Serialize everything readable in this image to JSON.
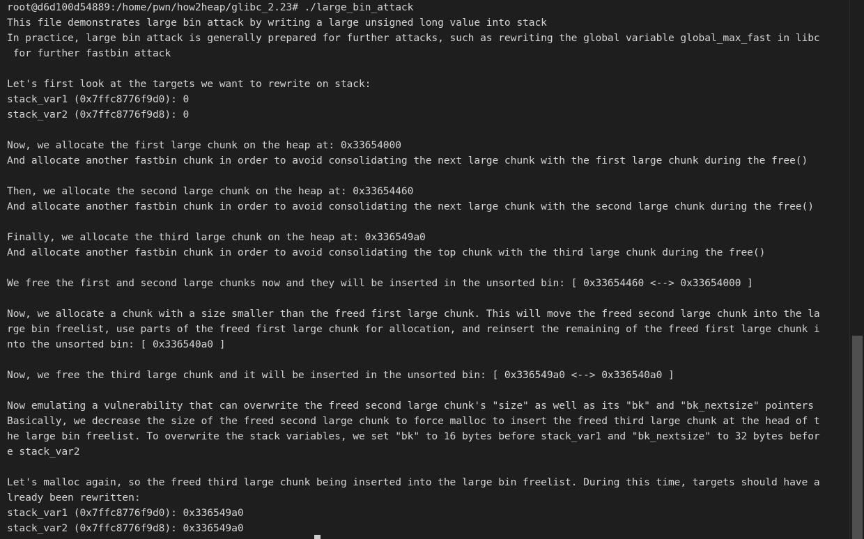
{
  "terminal": {
    "lines": [
      "root@d6d100d54889:/home/pwn/how2heap/glibc_2.23# ./large_bin_attack",
      "This file demonstrates large bin attack by writing a large unsigned long value into stack",
      "In practice, large bin attack is generally prepared for further attacks, such as rewriting the global variable global_max_fast in libc",
      " for further fastbin attack",
      "",
      "Let's first look at the targets we want to rewrite on stack:",
      "stack_var1 (0x7ffc8776f9d0): 0",
      "stack_var2 (0x7ffc8776f9d8): 0",
      "",
      "Now, we allocate the first large chunk on the heap at: 0x33654000",
      "And allocate another fastbin chunk in order to avoid consolidating the next large chunk with the first large chunk during the free()",
      "",
      "Then, we allocate the second large chunk on the heap at: 0x33654460",
      "And allocate another fastbin chunk in order to avoid consolidating the next large chunk with the second large chunk during the free()",
      "",
      "Finally, we allocate the third large chunk on the heap at: 0x336549a0",
      "And allocate another fastbin chunk in order to avoid consolidating the top chunk with the third large chunk during the free()",
      "",
      "We free the first and second large chunks now and they will be inserted in the unsorted bin: [ 0x33654460 <--> 0x33654000 ]",
      "",
      "Now, we allocate a chunk with a size smaller than the freed first large chunk. This will move the freed second large chunk into the la",
      "rge bin freelist, use parts of the freed first large chunk for allocation, and reinsert the remaining of the freed first large chunk i",
      "nto the unsorted bin: [ 0x336540a0 ]",
      "",
      "Now, we free the third large chunk and it will be inserted in the unsorted bin: [ 0x336549a0 <--> 0x336540a0 ]",
      "",
      "Now emulating a vulnerability that can overwrite the freed second large chunk's \"size\" as well as its \"bk\" and \"bk_nextsize\" pointers",
      "Basically, we decrease the size of the freed second large chunk to force malloc to insert the freed third large chunk at the head of t",
      "he large bin freelist. To overwrite the stack variables, we set \"bk\" to 16 bytes before stack_var1 and \"bk_nextsize\" to 32 bytes befor",
      "e stack_var2",
      "",
      "Let's malloc again, so the freed third large chunk being inserted into the large bin freelist. During this time, targets should have a",
      "lready been rewritten:",
      "stack_var1 (0x7ffc8776f9d0): 0x336549a0",
      "stack_var2 (0x7ffc8776f9d8): 0x336549a0"
    ]
  },
  "colors": {
    "background": "#1e1e1e",
    "text": "#d4d4d4",
    "scrollbar_thumb": "#4f4f4f",
    "cursor": "#cccccc"
  }
}
